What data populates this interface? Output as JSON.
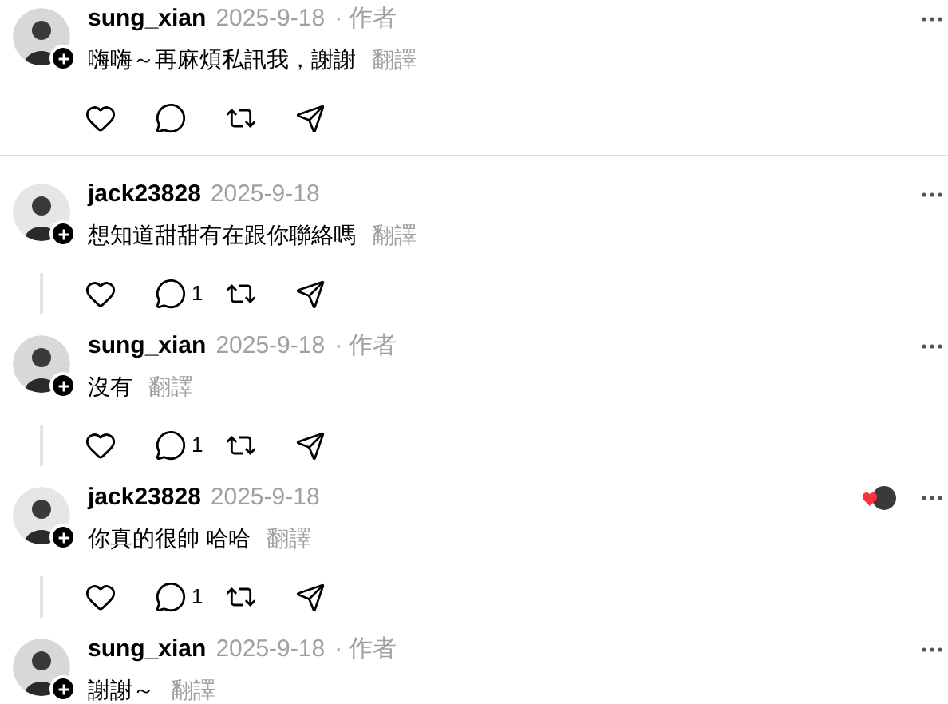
{
  "top_post": {
    "username": "sung_xian",
    "date": "2025-9-18",
    "author_tag": "· 作者",
    "text": "嗨嗨～再麻煩私訊我，謝謝",
    "translate": "翻譯",
    "liked_by_author": false,
    "thread_line": false
  },
  "replies": [
    {
      "username": "jack23828",
      "date": "2025-9-18",
      "text": "想知道甜甜有在跟你聯絡嗎",
      "translate": "翻譯",
      "reply_count": "1",
      "liked_by_author": false,
      "thread_line": true
    },
    {
      "username": "sung_xian",
      "date": "2025-9-18",
      "author_tag": "· 作者",
      "text": "沒有",
      "translate": "翻譯",
      "reply_count": "1",
      "liked_by_author": false,
      "thread_line": true
    },
    {
      "username": "jack23828",
      "date": "2025-9-18",
      "text": "你真的很帥 哈哈",
      "translate": "翻譯",
      "reply_count": "1",
      "liked_by_author": true,
      "thread_line": true
    },
    {
      "username": "sung_xian",
      "date": "2025-9-18",
      "author_tag": "· 作者",
      "text": "謝謝～",
      "translate": "翻譯",
      "liked_by_author": false,
      "thread_line": false
    }
  ]
}
